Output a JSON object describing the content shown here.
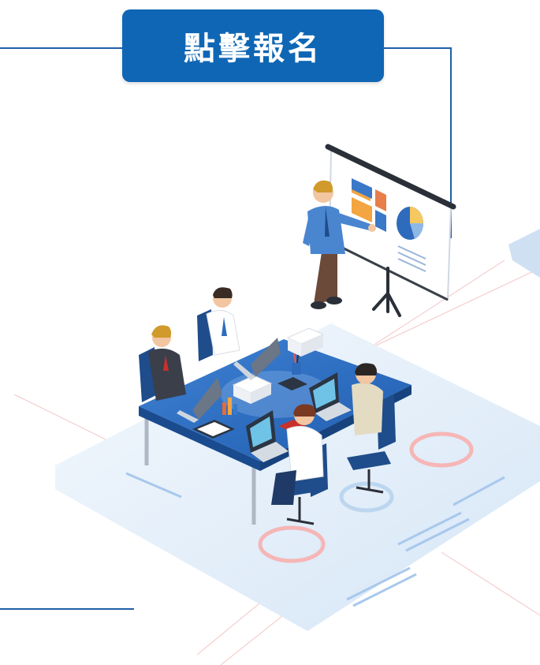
{
  "register_button": {
    "label": "點擊報名"
  },
  "colors": {
    "button_bg": "#0f66b4",
    "frame_line": "#1f5fa8",
    "table_top": "#2f6fc4",
    "platform": "#e4eef9"
  },
  "illustration": {
    "subject": "business-meeting",
    "icons": [
      "presenter",
      "projector-screen",
      "pie-chart",
      "meeting-table",
      "laptop",
      "office-chair",
      "coffee-cup",
      "document-stack"
    ]
  }
}
